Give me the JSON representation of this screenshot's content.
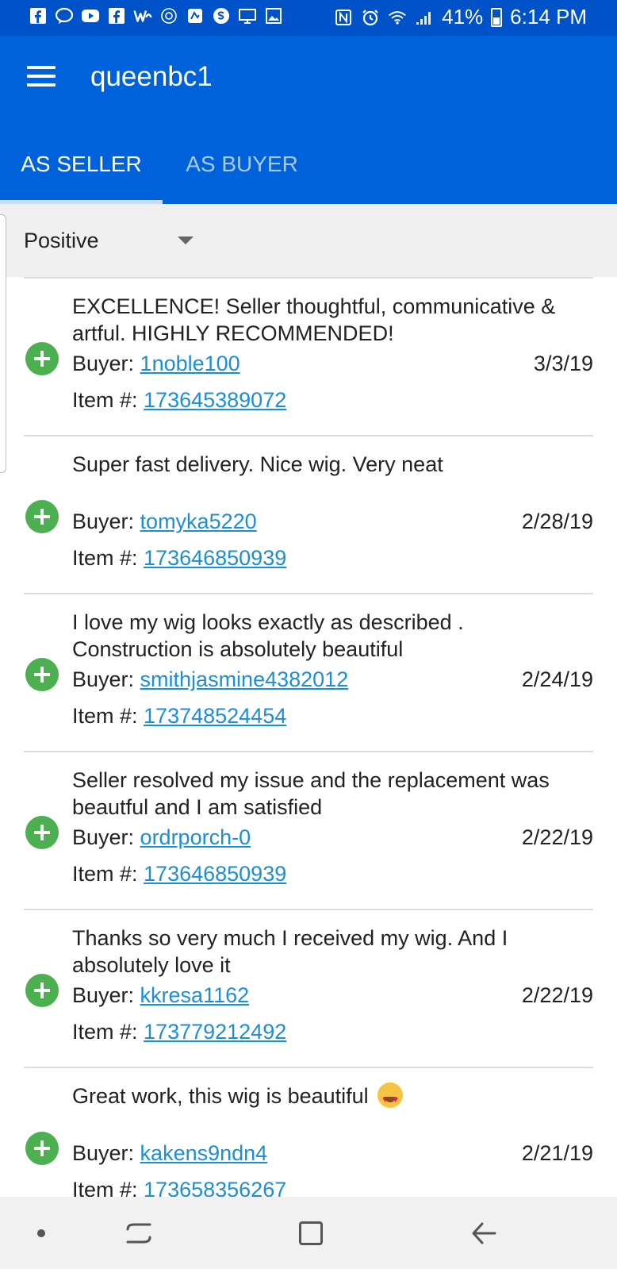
{
  "status_bar": {
    "left_icons": [
      "facebook-icon",
      "messenger-icon",
      "youtube-icon",
      "facebook-icon",
      "wattpad-icon",
      "app-icon",
      "app-icon",
      "skype-icon",
      "screen-icon",
      "image-icon"
    ],
    "right_icons": [
      "nfc-icon",
      "alarm-icon",
      "wifi-icon",
      "signal-icon"
    ],
    "battery": "41%",
    "time": "6:14 PM"
  },
  "header": {
    "title": "queenbc1",
    "tabs": [
      {
        "label": "AS SELLER",
        "active": true
      },
      {
        "label": "AS BUYER",
        "active": false
      }
    ]
  },
  "filter": {
    "selected": "Positive"
  },
  "feedback": [
    {
      "comment": "EXCELLENCE! Seller thoughtful, communicative & artful. HIGHLY RECOMMENDED!",
      "buyer_label": "Buyer: ",
      "buyer": "1noble100",
      "date": "3/3/19",
      "item_label": "Item #: ",
      "item": "173645389072"
    },
    {
      "comment": "Super fast delivery. Nice wig. Very neat",
      "buyer_label": "Buyer: ",
      "buyer": "tomyka5220",
      "date": "2/28/19",
      "item_label": "Item #: ",
      "item": "173646850939"
    },
    {
      "comment": "I love my wig looks exactly as described . Construction is absolutely beautiful",
      "buyer_label": "Buyer: ",
      "buyer": "smithjasmine4382012",
      "date": "2/24/19",
      "item_label": "Item #: ",
      "item": "173748524454"
    },
    {
      "comment": "Seller resolved my issue and the replacement was beautful and I am satisfied",
      "buyer_label": "Buyer: ",
      "buyer": "ordrporch-0",
      "date": "2/22/19",
      "item_label": "Item #: ",
      "item": "173646850939"
    },
    {
      "comment": "Thanks so very much I received my wig. And I absolutely love it",
      "buyer_label": "Buyer: ",
      "buyer": "kkresa1162",
      "date": "2/22/19",
      "item_label": "Item #: ",
      "item": "173779212492"
    },
    {
      "comment": "Great work, this wig is beautiful",
      "buyer_label": "Buyer: ",
      "buyer": "kakens9ndn4",
      "date": "2/21/19",
      "item_label": "Item #: ",
      "item": "173658356267"
    }
  ],
  "colors": {
    "status_bar": "#0052c9",
    "app_bar": "#0062da",
    "positive_icon": "#4caf50",
    "link": "#1a8fd8"
  }
}
